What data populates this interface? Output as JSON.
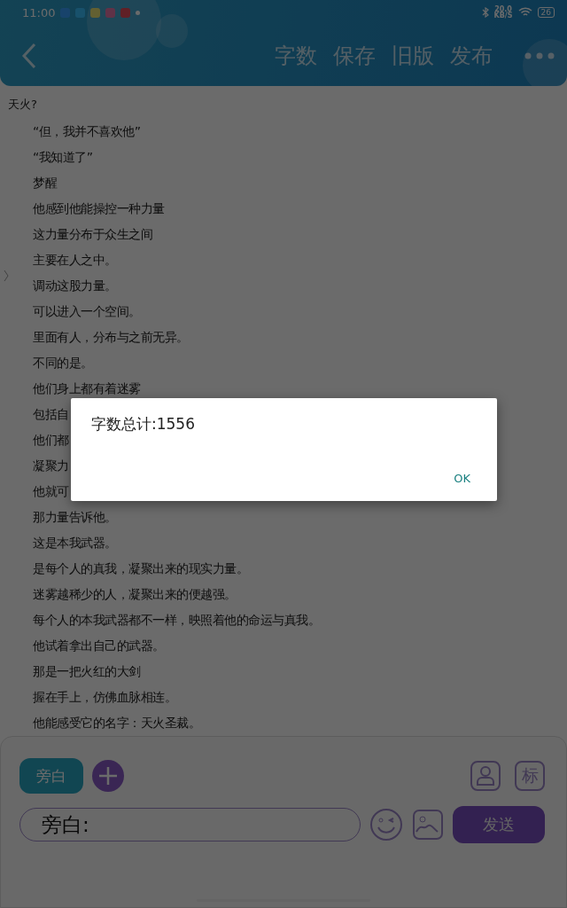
{
  "status_bar": {
    "time": "11:00",
    "speed": "20.0",
    "speed_unit": "KB/S",
    "battery": "26"
  },
  "toolbar": {
    "actions": [
      {
        "label": "字数"
      },
      {
        "label": "保存"
      },
      {
        "label": "旧版"
      },
      {
        "label": "发布"
      }
    ]
  },
  "document": {
    "title": "天火?",
    "lines": [
      "“但，我并不喜欢他”",
      "“我知道了”",
      "梦醒",
      "他感到他能操控一种力量",
      "这力量分布于众生之间",
      "主要在人之中。",
      "调动这股力量。",
      "可以进入一个空间。",
      "里面有人，分布与之前无异。",
      "不同的是。",
      "他们身上都有着迷雾",
      "包括自",
      "他们都",
      "凝聚力",
      "他就可",
      "那力量告诉他。",
      "这是本我武器。",
      "是每个人的真我，凝聚出来的现实力量。",
      "迷雾越稀少的人，凝聚出来的便越强。",
      "每个人的本我武器都不一样，映照着他的命运与真我。",
      "他试着拿出自己的武器。",
      "那是一把火红的大剑",
      "握在手上，仿佛血脉相连。",
      "他能感受它的名字：天火圣裁。"
    ]
  },
  "composer": {
    "role_chip": "旁白",
    "tag_button": "标",
    "input_value": "旁白:",
    "send_button": "发送"
  },
  "dialog": {
    "message": "字数总计:1556",
    "button": "OK"
  }
}
